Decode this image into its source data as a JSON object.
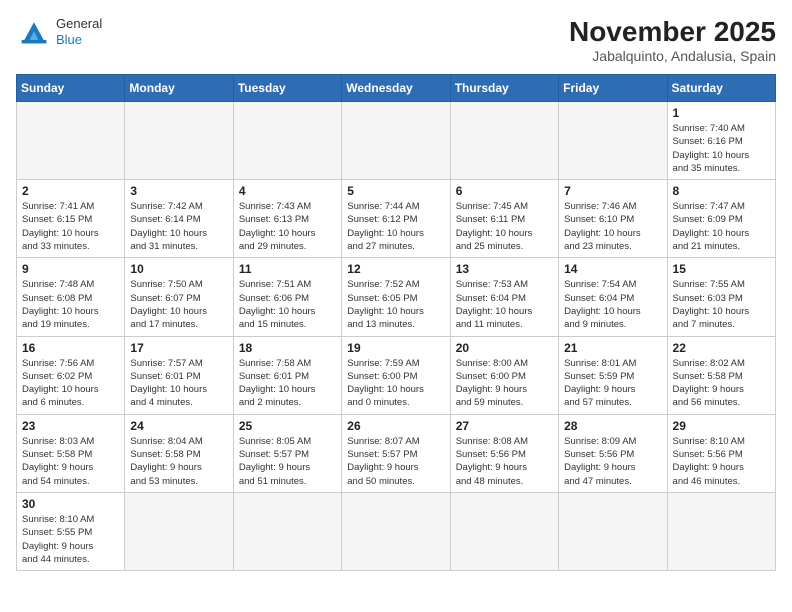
{
  "header": {
    "logo_general": "General",
    "logo_blue": "Blue",
    "month_year": "November 2025",
    "location": "Jabalquinto, Andalusia, Spain"
  },
  "weekdays": [
    "Sunday",
    "Monday",
    "Tuesday",
    "Wednesday",
    "Thursday",
    "Friday",
    "Saturday"
  ],
  "days": [
    {
      "num": "",
      "info": ""
    },
    {
      "num": "",
      "info": ""
    },
    {
      "num": "",
      "info": ""
    },
    {
      "num": "",
      "info": ""
    },
    {
      "num": "",
      "info": ""
    },
    {
      "num": "",
      "info": ""
    },
    {
      "num": "1",
      "info": "Sunrise: 7:40 AM\nSunset: 6:16 PM\nDaylight: 10 hours\nand 35 minutes."
    },
    {
      "num": "2",
      "info": "Sunrise: 7:41 AM\nSunset: 6:15 PM\nDaylight: 10 hours\nand 33 minutes."
    },
    {
      "num": "3",
      "info": "Sunrise: 7:42 AM\nSunset: 6:14 PM\nDaylight: 10 hours\nand 31 minutes."
    },
    {
      "num": "4",
      "info": "Sunrise: 7:43 AM\nSunset: 6:13 PM\nDaylight: 10 hours\nand 29 minutes."
    },
    {
      "num": "5",
      "info": "Sunrise: 7:44 AM\nSunset: 6:12 PM\nDaylight: 10 hours\nand 27 minutes."
    },
    {
      "num": "6",
      "info": "Sunrise: 7:45 AM\nSunset: 6:11 PM\nDaylight: 10 hours\nand 25 minutes."
    },
    {
      "num": "7",
      "info": "Sunrise: 7:46 AM\nSunset: 6:10 PM\nDaylight: 10 hours\nand 23 minutes."
    },
    {
      "num": "8",
      "info": "Sunrise: 7:47 AM\nSunset: 6:09 PM\nDaylight: 10 hours\nand 21 minutes."
    },
    {
      "num": "9",
      "info": "Sunrise: 7:48 AM\nSunset: 6:08 PM\nDaylight: 10 hours\nand 19 minutes."
    },
    {
      "num": "10",
      "info": "Sunrise: 7:50 AM\nSunset: 6:07 PM\nDaylight: 10 hours\nand 17 minutes."
    },
    {
      "num": "11",
      "info": "Sunrise: 7:51 AM\nSunset: 6:06 PM\nDaylight: 10 hours\nand 15 minutes."
    },
    {
      "num": "12",
      "info": "Sunrise: 7:52 AM\nSunset: 6:05 PM\nDaylight: 10 hours\nand 13 minutes."
    },
    {
      "num": "13",
      "info": "Sunrise: 7:53 AM\nSunset: 6:04 PM\nDaylight: 10 hours\nand 11 minutes."
    },
    {
      "num": "14",
      "info": "Sunrise: 7:54 AM\nSunset: 6:04 PM\nDaylight: 10 hours\nand 9 minutes."
    },
    {
      "num": "15",
      "info": "Sunrise: 7:55 AM\nSunset: 6:03 PM\nDaylight: 10 hours\nand 7 minutes."
    },
    {
      "num": "16",
      "info": "Sunrise: 7:56 AM\nSunset: 6:02 PM\nDaylight: 10 hours\nand 6 minutes."
    },
    {
      "num": "17",
      "info": "Sunrise: 7:57 AM\nSunset: 6:01 PM\nDaylight: 10 hours\nand 4 minutes."
    },
    {
      "num": "18",
      "info": "Sunrise: 7:58 AM\nSunset: 6:01 PM\nDaylight: 10 hours\nand 2 minutes."
    },
    {
      "num": "19",
      "info": "Sunrise: 7:59 AM\nSunset: 6:00 PM\nDaylight: 10 hours\nand 0 minutes."
    },
    {
      "num": "20",
      "info": "Sunrise: 8:00 AM\nSunset: 6:00 PM\nDaylight: 9 hours\nand 59 minutes."
    },
    {
      "num": "21",
      "info": "Sunrise: 8:01 AM\nSunset: 5:59 PM\nDaylight: 9 hours\nand 57 minutes."
    },
    {
      "num": "22",
      "info": "Sunrise: 8:02 AM\nSunset: 5:58 PM\nDaylight: 9 hours\nand 56 minutes."
    },
    {
      "num": "23",
      "info": "Sunrise: 8:03 AM\nSunset: 5:58 PM\nDaylight: 9 hours\nand 54 minutes."
    },
    {
      "num": "24",
      "info": "Sunrise: 8:04 AM\nSunset: 5:58 PM\nDaylight: 9 hours\nand 53 minutes."
    },
    {
      "num": "25",
      "info": "Sunrise: 8:05 AM\nSunset: 5:57 PM\nDaylight: 9 hours\nand 51 minutes."
    },
    {
      "num": "26",
      "info": "Sunrise: 8:07 AM\nSunset: 5:57 PM\nDaylight: 9 hours\nand 50 minutes."
    },
    {
      "num": "27",
      "info": "Sunrise: 8:08 AM\nSunset: 5:56 PM\nDaylight: 9 hours\nand 48 minutes."
    },
    {
      "num": "28",
      "info": "Sunrise: 8:09 AM\nSunset: 5:56 PM\nDaylight: 9 hours\nand 47 minutes."
    },
    {
      "num": "29",
      "info": "Sunrise: 8:10 AM\nSunset: 5:56 PM\nDaylight: 9 hours\nand 46 minutes."
    },
    {
      "num": "30",
      "info": "Sunrise: 8:10 AM\nSunset: 5:55 PM\nDaylight: 9 hours\nand 44 minutes."
    },
    {
      "num": "",
      "info": ""
    },
    {
      "num": "",
      "info": ""
    },
    {
      "num": "",
      "info": ""
    },
    {
      "num": "",
      "info": ""
    },
    {
      "num": "",
      "info": ""
    },
    {
      "num": "",
      "info": ""
    }
  ]
}
